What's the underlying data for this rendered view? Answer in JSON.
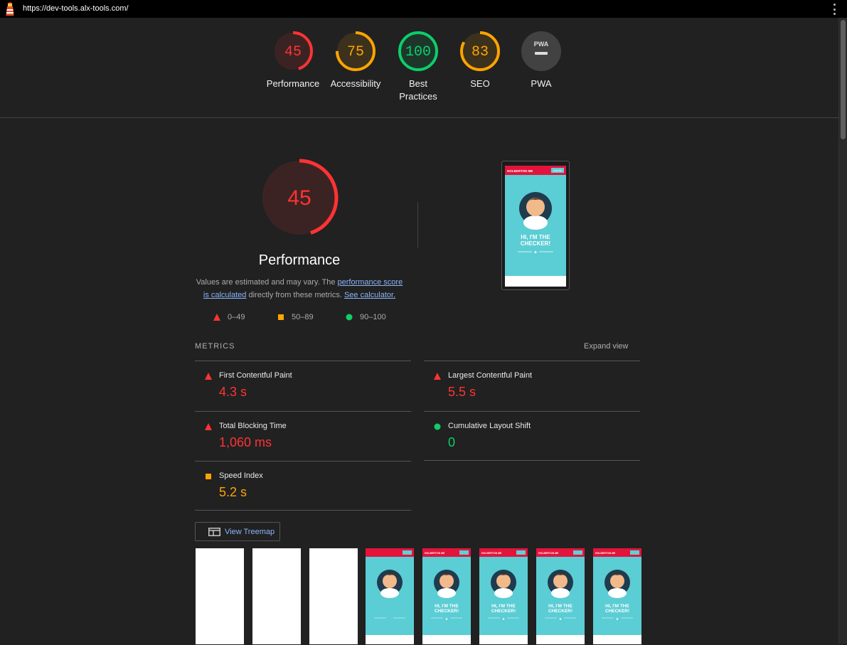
{
  "browser": {
    "url": "https://dev-tools.alx-tools.com/"
  },
  "summary": {
    "gauges": [
      {
        "label": "Performance",
        "value": "45",
        "score": 45,
        "color": "#ff3333"
      },
      {
        "label": "Accessibility",
        "value": "75",
        "score": 75,
        "color": "#ffa400"
      },
      {
        "label": "Best Practices",
        "value": "100",
        "score": 100,
        "color": "#0cce6b"
      },
      {
        "label": "SEO",
        "value": "83",
        "score": 83,
        "color": "#ffa400"
      },
      {
        "label": "PWA",
        "value": "PWA",
        "color": "#9e9e9e"
      }
    ]
  },
  "performance": {
    "score": "45",
    "score_fraction": 0.45,
    "title": "Performance",
    "desc_prefix": "Values are estimated and may vary. The ",
    "desc_link1": "performance score is calculated",
    "desc_middle": " directly from these metrics. ",
    "desc_link2": "See calculator.",
    "legend": [
      {
        "range": "0–49",
        "color": "#ff3333",
        "shape": "triangle"
      },
      {
        "range": "50–89",
        "color": "#ffa400",
        "shape": "square"
      },
      {
        "range": "90–100",
        "color": "#0cce6b",
        "shape": "circle"
      }
    ]
  },
  "screenshot": {
    "brand": "HOLBERTON ME",
    "button": "HIRE ME",
    "headline_1": "HI, I'M THE",
    "headline_2": "CHECKER!"
  },
  "metrics": {
    "heading": "METRICS",
    "expand_label": "Expand view",
    "items": [
      {
        "name": "First Contentful Paint",
        "value": "4.3 s",
        "color": "#ff3333",
        "shape": "triangle"
      },
      {
        "name": "Largest Contentful Paint",
        "value": "5.5 s",
        "color": "#ff3333",
        "shape": "triangle"
      },
      {
        "name": "Total Blocking Time",
        "value": "1,060 ms",
        "color": "#ff3333",
        "shape": "triangle"
      },
      {
        "name": "Cumulative Layout Shift",
        "value": "0",
        "color": "#0cce6b",
        "shape": "circle"
      },
      {
        "name": "Speed Index",
        "value": "5.2 s",
        "color": "#ffa400",
        "shape": "square"
      }
    ]
  },
  "treemap": {
    "label": "View Treemap"
  },
  "filmstrip": {
    "frames": [
      "blank",
      "blank",
      "blank",
      "partial",
      "full",
      "full",
      "full",
      "full"
    ],
    "brand": "HOLBERTON ME",
    "headline_1": "HI, I'M THE",
    "headline_2": "CHECKER!"
  }
}
